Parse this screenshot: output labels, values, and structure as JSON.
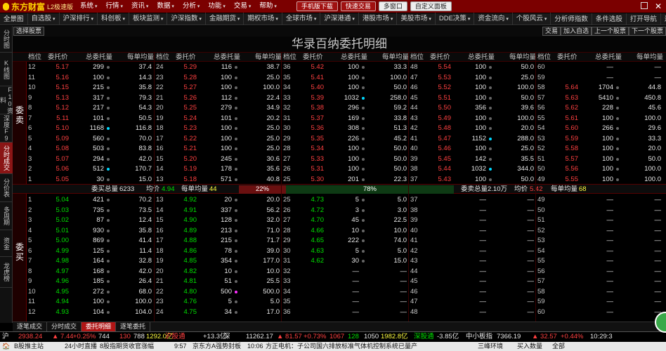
{
  "app": {
    "logo": "东方财富",
    "edition": "L2极速版"
  },
  "menu": [
    "系统",
    "行情",
    "资讯",
    "数据",
    "分析",
    "功能",
    "交易",
    "帮助"
  ],
  "top_buttons": [
    "手机版下载",
    "快速交易",
    "多窗口",
    "自定义面板"
  ],
  "nav": [
    "全景图",
    "自选股",
    "沪深排行",
    "科创板",
    "板块监测",
    "沪深指数",
    "金融期货",
    "期权市场",
    "全球市场",
    "沪深港通",
    "港股市场",
    "美股市场",
    "DDE决策",
    "资金流向",
    "个股风云",
    "分析师指数",
    "条件选股",
    "打开导航",
    "返回"
  ],
  "sidebar": [
    "分时图",
    "K线图",
    "F10资料",
    "深度F9",
    "分时成交",
    "分价表",
    "多周期",
    "资金",
    "龙虎榜"
  ],
  "toolbar": {
    "select_stock": "选择股票",
    "right": [
      "交易",
      "加入自选",
      "上一个股票",
      "下一个股票"
    ]
  },
  "page_title": "华录百纳委托明细",
  "col_headers": [
    "档位",
    "委托价",
    "总委托量",
    "每单均量"
  ],
  "sell_label": "委卖",
  "buy_label": "委买",
  "sell_rows": [
    [
      [
        "12",
        "5.17",
        "299",
        "37.4"
      ],
      [
        "24",
        "5.29",
        "116",
        "38.7"
      ],
      [
        "36",
        "5.42",
        "100",
        "33.3"
      ],
      [
        "48",
        "5.54",
        "100",
        "50.0"
      ],
      [
        "60",
        "",
        "—",
        "—"
      ]
    ],
    [
      [
        "11",
        "5.16",
        "100",
        "14.3"
      ],
      [
        "23",
        "5.28",
        "100",
        "25.0"
      ],
      [
        "35",
        "5.41",
        "100",
        "100.0"
      ],
      [
        "47",
        "5.53",
        "100",
        "25.0"
      ],
      [
        "59",
        "",
        "—",
        "—"
      ]
    ],
    [
      [
        "10",
        "5.15",
        "215",
        "35.8"
      ],
      [
        "22",
        "5.27",
        "100",
        "100.0"
      ],
      [
        "34",
        "5.40",
        "100",
        "50.0"
      ],
      [
        "46",
        "5.52",
        "100",
        "100.0"
      ],
      [
        "58",
        "5.64",
        "1704",
        "44.8"
      ]
    ],
    [
      [
        "9",
        "5.13",
        "317",
        "79.3"
      ],
      [
        "21",
        "5.26",
        "112",
        "22.4"
      ],
      [
        "33",
        "5.39",
        "1032",
        "258.0"
      ],
      [
        "45",
        "5.51",
        "100",
        "50.0"
      ],
      [
        "57",
        "5.63",
        "5410",
        "450.8"
      ]
    ],
    [
      [
        "8",
        "5.12",
        "217",
        "54.3"
      ],
      [
        "20",
        "5.25",
        "279",
        "34.9"
      ],
      [
        "32",
        "5.38",
        "296",
        "59.2"
      ],
      [
        "44",
        "5.50",
        "356",
        "39.6"
      ],
      [
        "56",
        "5.62",
        "228",
        "45.6"
      ]
    ],
    [
      [
        "7",
        "5.11",
        "101",
        "50.5"
      ],
      [
        "19",
        "5.24",
        "101",
        "20.2"
      ],
      [
        "31",
        "5.37",
        "169",
        "33.8"
      ],
      [
        "43",
        "5.49",
        "100",
        "100.0"
      ],
      [
        "55",
        "5.61",
        "100",
        "100.0"
      ]
    ],
    [
      [
        "6",
        "5.10",
        "1168",
        "116.8"
      ],
      [
        "18",
        "5.23",
        "100",
        "25.0"
      ],
      [
        "30",
        "5.36",
        "308",
        "51.3"
      ],
      [
        "42",
        "5.48",
        "100",
        "20.0"
      ],
      [
        "54",
        "5.60",
        "266",
        "29.6"
      ]
    ],
    [
      [
        "5",
        "5.09",
        "560",
        "70.0"
      ],
      [
        "17",
        "5.22",
        "100",
        "25.0"
      ],
      [
        "29",
        "5.35",
        "226",
        "45.2"
      ],
      [
        "41",
        "5.47",
        "1152",
        "288.0"
      ],
      [
        "53",
        "5.59",
        "100",
        "33.3"
      ]
    ],
    [
      [
        "4",
        "5.08",
        "503",
        "83.8"
      ],
      [
        "16",
        "5.21",
        "100",
        "25.0"
      ],
      [
        "28",
        "5.34",
        "100",
        "50.0"
      ],
      [
        "40",
        "5.46",
        "100",
        "25.0"
      ],
      [
        "52",
        "5.58",
        "100",
        "20.0"
      ]
    ],
    [
      [
        "3",
        "5.07",
        "294",
        "42.0"
      ],
      [
        "15",
        "5.20",
        "245",
        "30.6"
      ],
      [
        "27",
        "5.33",
        "100",
        "50.0"
      ],
      [
        "39",
        "5.45",
        "142",
        "35.5"
      ],
      [
        "51",
        "5.57",
        "100",
        "50.0"
      ]
    ],
    [
      [
        "2",
        "5.06",
        "512",
        "170.7"
      ],
      [
        "14",
        "5.19",
        "178",
        "35.6"
      ],
      [
        "26",
        "5.31",
        "100",
        "50.0"
      ],
      [
        "38",
        "5.44",
        "1032",
        "344.0"
      ],
      [
        "50",
        "5.56",
        "100",
        "100.0"
      ]
    ],
    [
      [
        "1",
        "5.05",
        "30",
        "15.0"
      ],
      [
        "13",
        "5.18",
        "571",
        "40.8"
      ],
      [
        "25",
        "5.30",
        "201",
        "22.3"
      ],
      [
        "37",
        "5.43",
        "100",
        "50.0"
      ],
      [
        "49",
        "5.55",
        "100",
        "100.0"
      ]
    ]
  ],
  "buy_rows": [
    [
      [
        "1",
        "5.04",
        "421",
        "70.2"
      ],
      [
        "13",
        "4.92",
        "20",
        "20.0"
      ],
      [
        "25",
        "4.73",
        "5",
        "5.0"
      ],
      [
        "37",
        "",
        "—",
        "—"
      ],
      [
        "49",
        "",
        "—",
        "—"
      ]
    ],
    [
      [
        "2",
        "5.03",
        "735",
        "73.5"
      ],
      [
        "14",
        "4.91",
        "337",
        "56.2"
      ],
      [
        "26",
        "4.72",
        "3",
        "3.0"
      ],
      [
        "38",
        "",
        "—",
        "—"
      ],
      [
        "50",
        "",
        "—",
        "—"
      ]
    ],
    [
      [
        "3",
        "5.02",
        "87",
        "12.4"
      ],
      [
        "15",
        "4.90",
        "128",
        "32.0"
      ],
      [
        "27",
        "4.70",
        "45",
        "22.5"
      ],
      [
        "39",
        "",
        "—",
        "—"
      ],
      [
        "51",
        "",
        "—",
        "—"
      ]
    ],
    [
      [
        "4",
        "5.01",
        "930",
        "35.8"
      ],
      [
        "16",
        "4.89",
        "213",
        "71.0"
      ],
      [
        "28",
        "4.66",
        "10",
        "10.0"
      ],
      [
        "40",
        "",
        "—",
        "—"
      ],
      [
        "52",
        "",
        "—",
        "—"
      ]
    ],
    [
      [
        "5",
        "5.00",
        "869",
        "41.4"
      ],
      [
        "17",
        "4.88",
        "215",
        "71.7"
      ],
      [
        "29",
        "4.65",
        "222",
        "74.0"
      ],
      [
        "41",
        "",
        "—",
        "—"
      ],
      [
        "53",
        "",
        "—",
        "—"
      ]
    ],
    [
      [
        "6",
        "4.99",
        "125",
        "11.4"
      ],
      [
        "18",
        "4.86",
        "78",
        "39.0"
      ],
      [
        "30",
        "4.63",
        "5",
        "5.0"
      ],
      [
        "42",
        "",
        "—",
        "—"
      ],
      [
        "54",
        "",
        "—",
        "—"
      ]
    ],
    [
      [
        "7",
        "4.98",
        "164",
        "32.8"
      ],
      [
        "19",
        "4.85",
        "354",
        "177.0"
      ],
      [
        "31",
        "4.62",
        "30",
        "15.0"
      ],
      [
        "43",
        "",
        "—",
        "—"
      ],
      [
        "55",
        "",
        "—",
        "—"
      ]
    ],
    [
      [
        "8",
        "4.97",
        "168",
        "42.0"
      ],
      [
        "20",
        "4.82",
        "10",
        "10.0"
      ],
      [
        "32",
        "",
        "—",
        "—"
      ],
      [
        "44",
        "",
        "—",
        "—"
      ],
      [
        "56",
        "",
        "—",
        "—"
      ]
    ],
    [
      [
        "9",
        "4.96",
        "185",
        "26.4"
      ],
      [
        "21",
        "4.81",
        "51",
        "25.5"
      ],
      [
        "33",
        "",
        "—",
        "—"
      ],
      [
        "45",
        "",
        "—",
        "—"
      ],
      [
        "57",
        "",
        "—",
        "—"
      ]
    ],
    [
      [
        "10",
        "4.95",
        "272",
        "68.0"
      ],
      [
        "22",
        "4.80",
        "500",
        "500.0"
      ],
      [
        "34",
        "",
        "—",
        "—"
      ],
      [
        "46",
        "",
        "—",
        "—"
      ],
      [
        "58",
        "",
        "—",
        "—"
      ]
    ],
    [
      [
        "11",
        "4.94",
        "100",
        "100.0"
      ],
      [
        "23",
        "4.76",
        "5",
        "5.0"
      ],
      [
        "35",
        "",
        "—",
        "—"
      ],
      [
        "47",
        "",
        "—",
        "—"
      ],
      [
        "59",
        "",
        "—",
        "—"
      ]
    ],
    [
      [
        "12",
        "4.93",
        "104",
        "104.0"
      ],
      [
        "24",
        "4.75",
        "34",
        "17.0"
      ],
      [
        "36",
        "",
        "—",
        "—"
      ],
      [
        "48",
        "",
        "—",
        "—"
      ],
      [
        "60",
        "",
        "—",
        "—"
      ]
    ]
  ],
  "sell_dots": {
    "6": {
      "0": "cy"
    },
    "3": {
      "2": "cy"
    },
    "7": {
      "3": "cy"
    },
    "10": {
      "0": "cy",
      "3": "cy"
    }
  },
  "buy_dots": {
    "9": {
      "1": "mg"
    }
  },
  "summary": {
    "buy_total_label": "委买总量",
    "buy_total": "6233",
    "avg_label": "均价",
    "buy_avg": "4.94",
    "per_order_label": "每单均量",
    "buy_per_order": "44",
    "buy_pct": "22%",
    "sell_pct": "78%",
    "buy_fraction": 0.22,
    "sell_total_label": "委卖总量",
    "sell_total": "2.10万",
    "sell_avg_label": "均价",
    "sell_avg": "5.42",
    "sell_per_order_label": "每单均量",
    "sell_per_order": "68"
  },
  "bottom_tabs": [
    "逐笔成交",
    "分时成交",
    "委托明细",
    "逐笔委托"
  ],
  "status": [
    [
      "沪",
      "wht"
    ],
    [
      "2938.24",
      "red"
    ],
    [
      "▲ 7.44",
      "red"
    ],
    [
      "+0.25%",
      "red"
    ],
    [
      "744",
      "wht"
    ],
    [
      "130",
      "red"
    ],
    [
      "788",
      "wht"
    ],
    [
      "1292.0亿",
      "yel"
    ],
    [
      "沪股通",
      "red"
    ],
    [
      "+13.3亿",
      "wht"
    ],
    [
      "深",
      "wht"
    ],
    [
      "11262.17",
      "wht"
    ],
    [
      "▲ 81.57",
      "red"
    ],
    [
      "+0.73%",
      "red"
    ],
    [
      "1067",
      "red"
    ],
    [
      "128",
      "grn"
    ],
    [
      "1050",
      "wht"
    ],
    [
      "1982.8亿",
      "yel"
    ],
    [
      "深股通",
      "grn"
    ],
    [
      "-3.85亿",
      "wht"
    ],
    [
      "中小板指",
      "wht"
    ],
    [
      "7366.19",
      "wht"
    ],
    [
      "▲ 32.57",
      "red"
    ],
    [
      "+0.44%",
      "red"
    ],
    [
      "10:29:3",
      "wht"
    ]
  ],
  "ticker": [
    "🏠",
    "B股推主站",
    "24小时直播",
    "8股指期货收官涨幅",
    "9:57",
    "京东方A强势封板",
    "10:06",
    "方正电机：子公司国六排放标准气体机控制系统已量产",
    "三峰环境",
    "买入数量",
    "全部"
  ]
}
